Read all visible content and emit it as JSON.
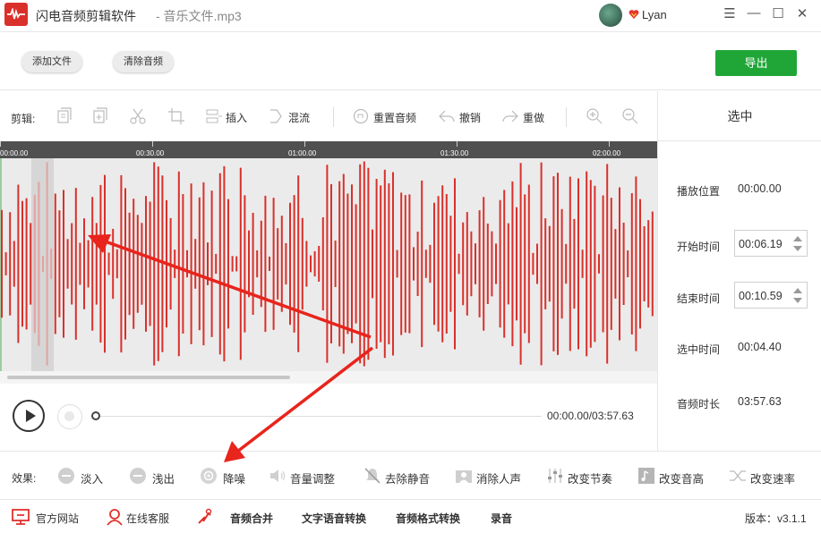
{
  "window": {
    "app_title": "闪电音频剪辑软件",
    "file_title": "- 音乐文件.mp3",
    "username": "Lyan",
    "controls": [
      "☰",
      "—",
      "☐",
      "✕"
    ]
  },
  "toolbar_top": {
    "add_file": "添加文件",
    "clear_audio": "清除音频",
    "export": "导出"
  },
  "edit_toolbar": {
    "label": "剪辑:",
    "insert": "插入",
    "mix": "混流",
    "reset_audio": "重置音频",
    "undo": "撤销",
    "redo": "重做"
  },
  "timeline": {
    "ticks": [
      "00:00.00",
      "00:30.00",
      "01:00.00",
      "01:30.00",
      "02:00.00"
    ]
  },
  "player": {
    "time": "00:00.00/03:57.63",
    "progress": 0
  },
  "right_panel": {
    "heading": "选中",
    "play_position_label": "播放位置",
    "play_position": "00:00.00",
    "start_label": "开始时间",
    "start": "00:06.19",
    "end_label": "结束时间",
    "end": "00:10.59",
    "selected_label": "选中时间",
    "selected": "00:04.40",
    "duration_label": "音频时长",
    "duration": "03:57.63"
  },
  "effects": {
    "label": "效果:",
    "fade_in": "淡入",
    "fade_out": "浅出",
    "denoise": "降噪",
    "volume": "音量调整",
    "remove_silence": "去除静音",
    "remove_vocals": "消除人声",
    "tempo": "改变节奏",
    "pitch": "改变音高",
    "speed": "改变速率"
  },
  "footer": {
    "website": "官方网站",
    "support": "在线客服",
    "merge": "音频合并",
    "tts": "文字语音转换",
    "format": "音频格式转换",
    "record": "录音",
    "version": "版本：v3.1.1"
  },
  "colors": {
    "waveform": "#d9302b",
    "export_button": "#20a637",
    "annotation_arrow": "#e8241c"
  }
}
